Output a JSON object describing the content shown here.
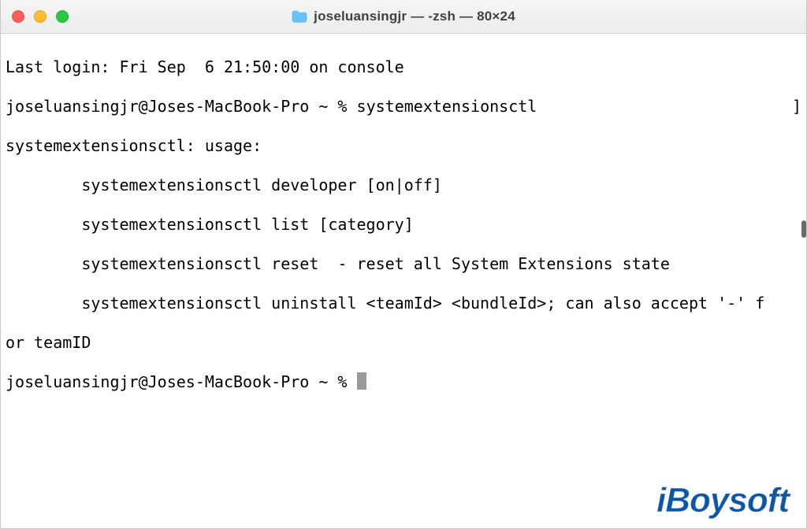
{
  "window": {
    "title": "joseluansingjr — -zsh — 80×24"
  },
  "terminal": {
    "last_login": "Last login: Fri Sep  6 21:50:00 on console",
    "prompt1_prefix": "joseluansingjr@Joses-MacBook-Pro ~ % ",
    "prompt1_cmd": "systemextensionsctl",
    "prompt1_trail": "]",
    "usage_header": "systemextensionsctl: usage:",
    "usage_lines": [
      "        systemextensionsctl developer [on|off]",
      "        systemextensionsctl list [category]",
      "        systemextensionsctl reset  - reset all System Extensions state",
      "        systemextensionsctl uninstall <teamId> <bundleId>; can also accept '-' f",
      "or teamID"
    ],
    "prompt2_prefix": "joseluansingjr@Joses-MacBook-Pro ~ % "
  },
  "watermark": "iBoysoft"
}
